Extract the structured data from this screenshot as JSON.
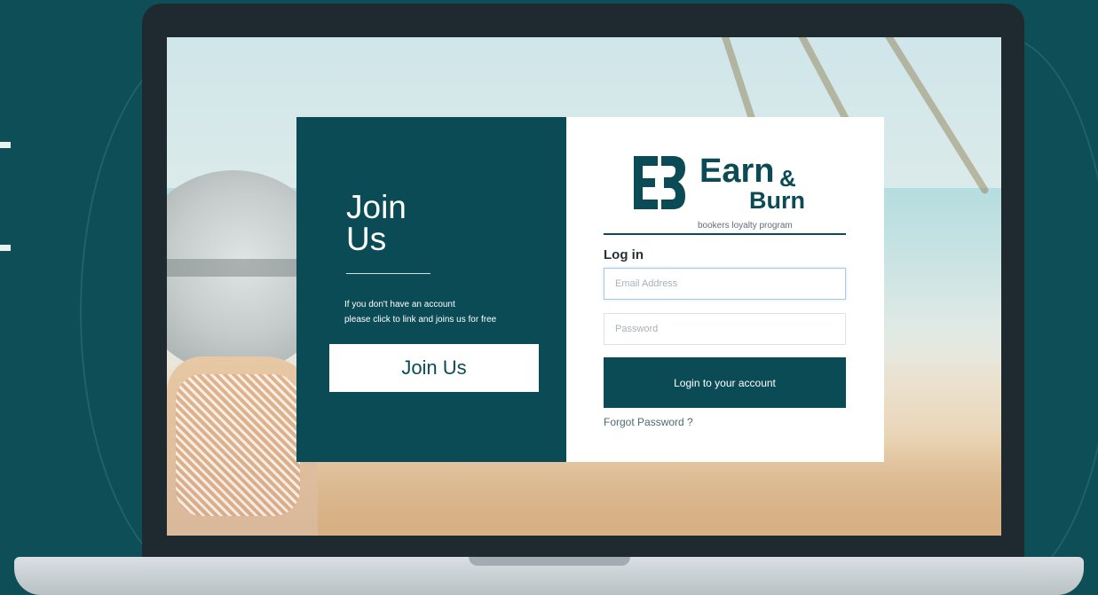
{
  "colors": {
    "brand_teal": "#0b4b56",
    "background": "#0e4f57",
    "laptop_frame": "#1f2a30",
    "input_border_focus": "#a7c8e6"
  },
  "join": {
    "title": "Join\nUs",
    "description_line1": "If you don't have an account",
    "description_line2": "please click to link and joins us for free",
    "button_label": "Join Us"
  },
  "brand": {
    "logo_icon": "eb-logo-icon",
    "name_part1": "Earn",
    "ampersand": "&",
    "name_part2": "Burn",
    "tagline": "bookers loyalty program"
  },
  "login": {
    "heading": "Log in",
    "email_placeholder": "Email Address",
    "email_value": "",
    "password_placeholder": "Password",
    "password_value": "",
    "submit_label": "Login to your account",
    "forgot_label": "Forgot Password ?"
  }
}
